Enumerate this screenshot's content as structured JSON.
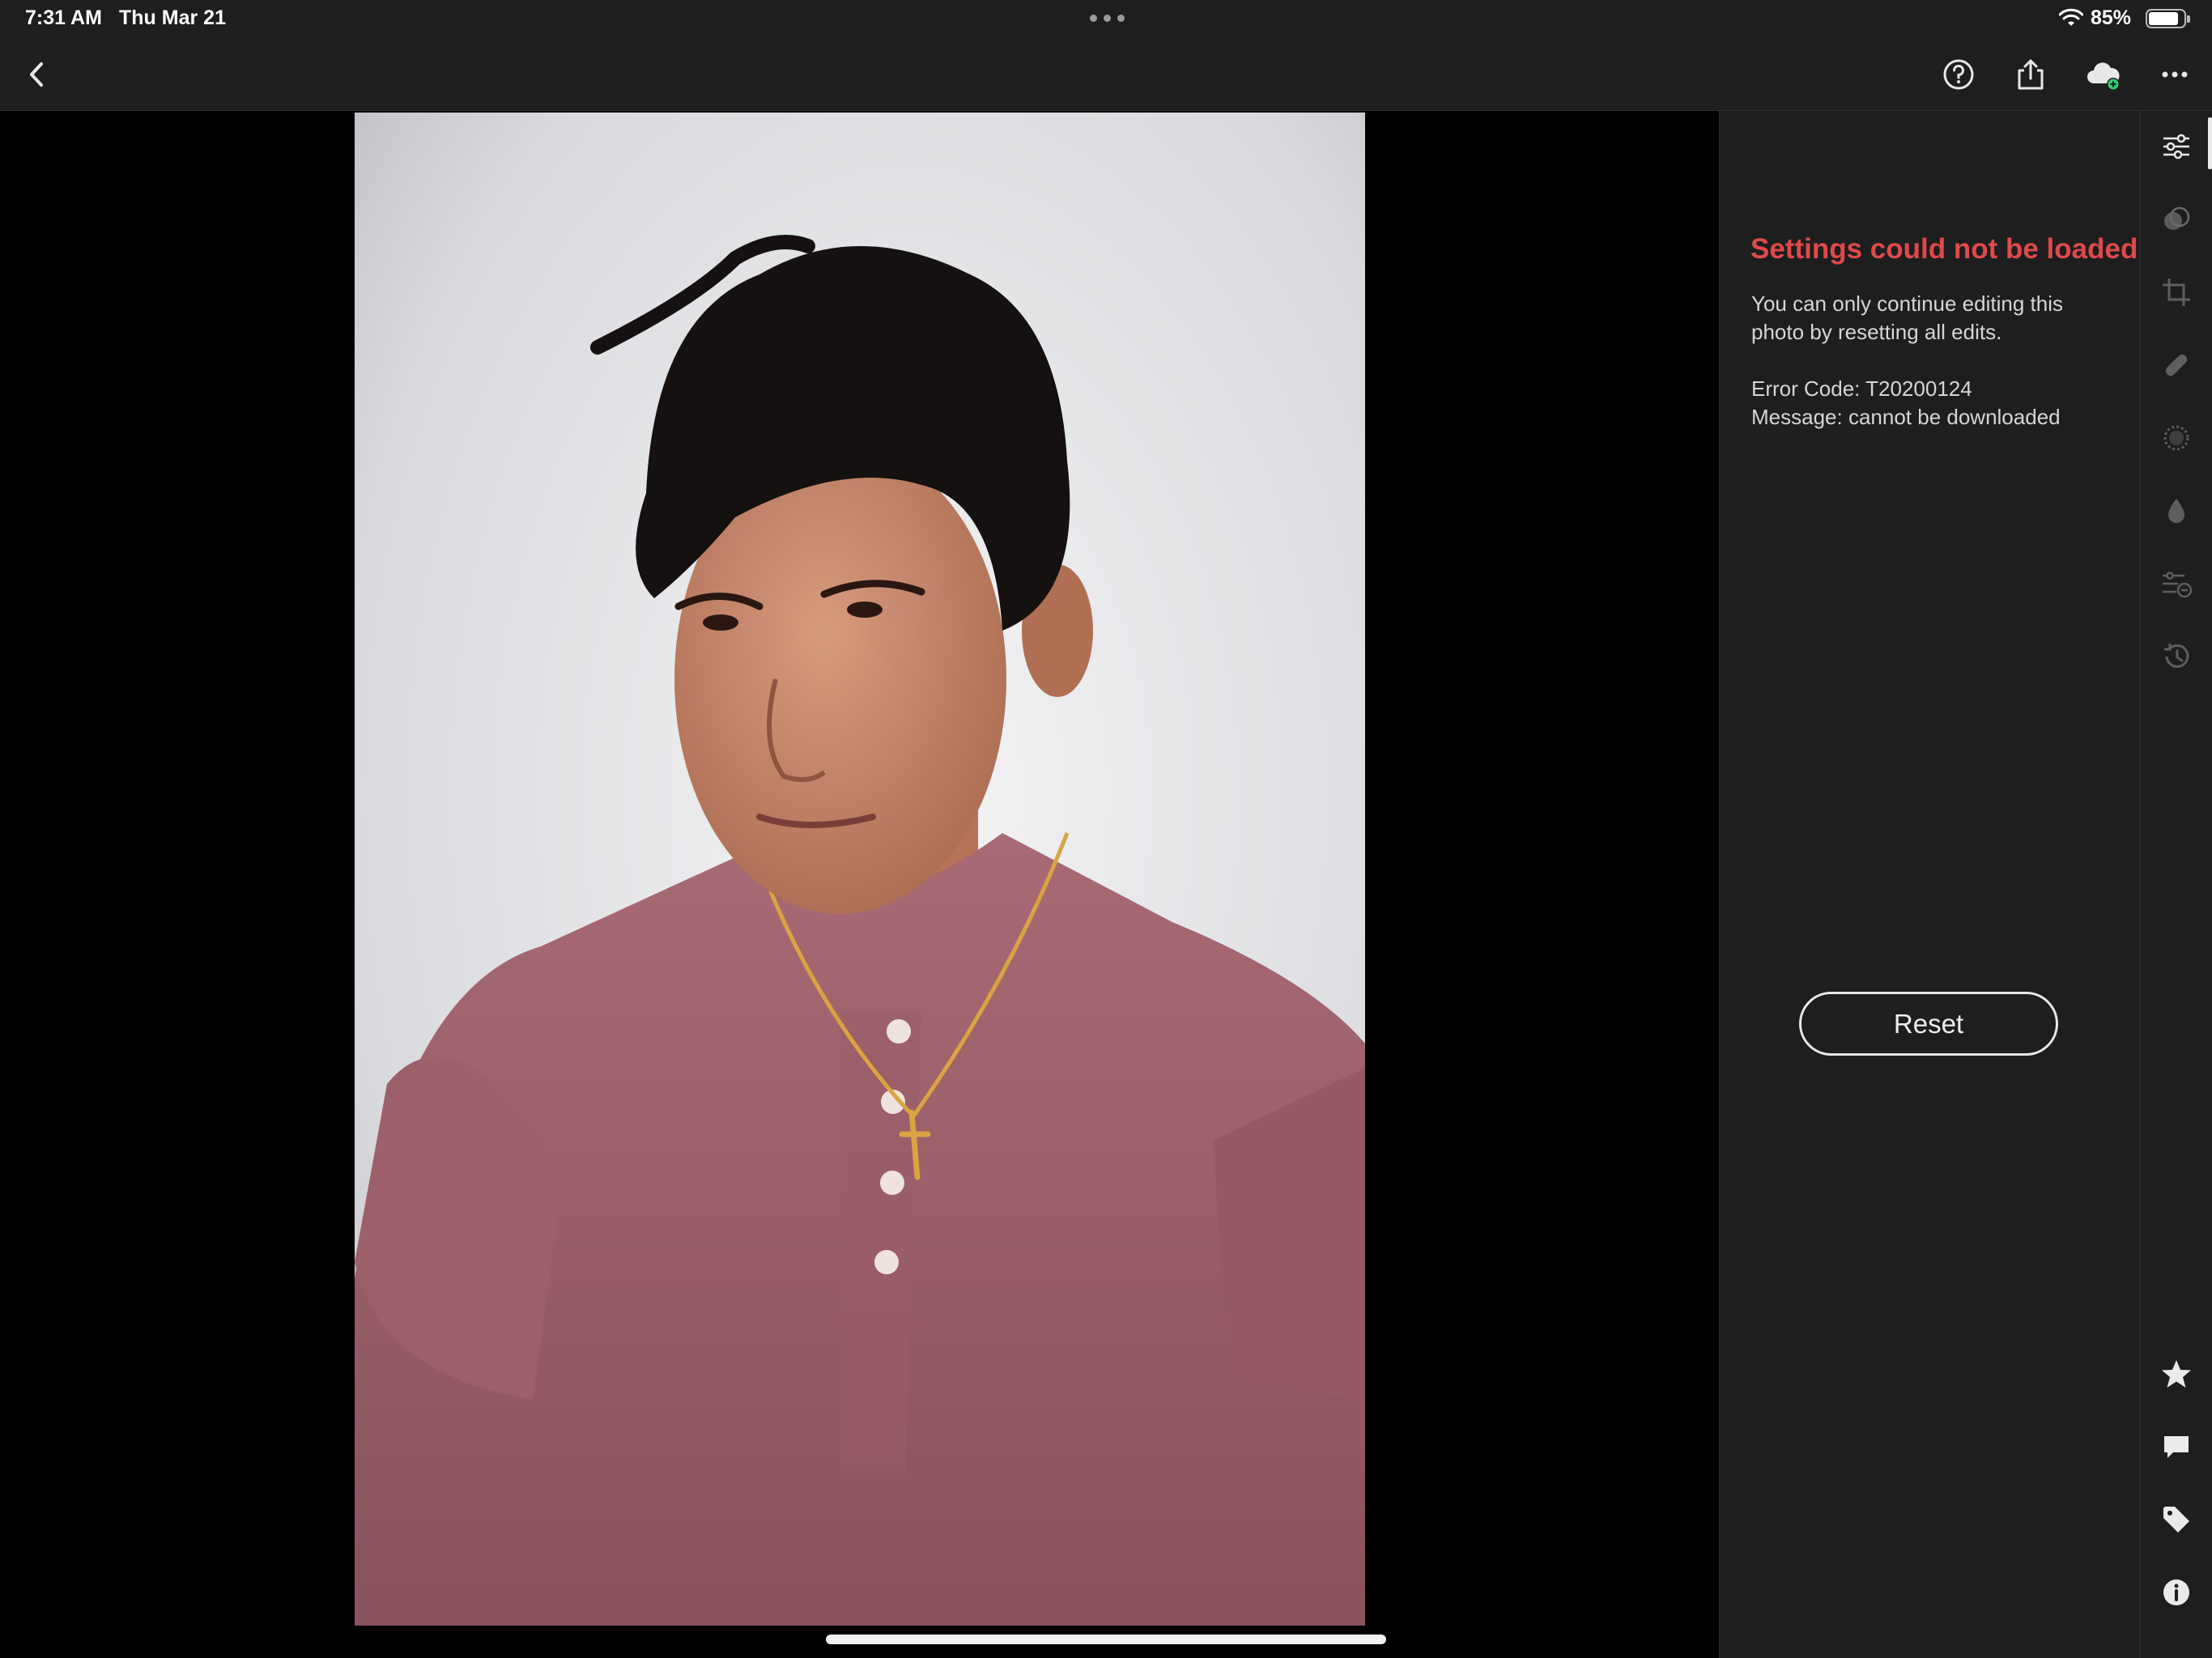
{
  "status_bar": {
    "time": "7:31 AM",
    "date": "Thu Mar 21",
    "battery_percent": "85%",
    "battery_level": 0.85
  },
  "toolbar": {
    "back_icon": "chevron-left-icon",
    "help_icon": "help-circle-icon",
    "share_icon": "share-icon",
    "cloud_icon": "cloud-sync-icon",
    "more_icon": "more-horizontal-icon"
  },
  "error_panel": {
    "title": "Settings could not be loaded",
    "body": "You can only continue editing this photo by resetting all edits.",
    "error_code_line": "Error Code: T20200124",
    "message_line": "Message: cannot be downloaded",
    "reset_label": "Reset"
  },
  "tool_rail": {
    "top_tools": [
      "edit-sliders-icon",
      "presets-icon",
      "crop-icon",
      "healing-icon",
      "masking-icon",
      "color-mix-icon",
      "versions-icon",
      "history-icon"
    ],
    "bottom_tools": [
      "rating-star-icon",
      "comment-icon",
      "keyword-tag-icon",
      "info-icon"
    ],
    "active": "edit-sliders-icon"
  },
  "colors": {
    "error_red": "#e04a4a",
    "panel_bg": "#1e1e1e",
    "cloud_badge_green": "#2ecc71"
  }
}
